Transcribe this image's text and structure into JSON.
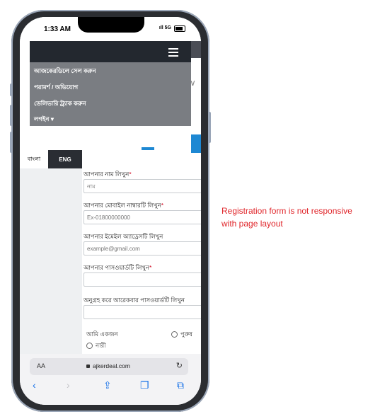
{
  "status": {
    "time": "1:33 AM",
    "signal": "5G"
  },
  "nav_menu": {
    "items": [
      "আজকেরডিলে সেল করুন",
      "পরামর্শ / অভিযোগ",
      "ডেলিভারি ট্র্যাক করুন",
      "লগইন ▾"
    ]
  },
  "language": {
    "bangla": "বাংলা",
    "english": "ENG"
  },
  "form": {
    "name_label": "আপনার নাম লিখুন",
    "name_placeholder": "নাম",
    "mobile_label": "আপনার মোবাইল নাম্বারটি লিখুন",
    "mobile_placeholder": "Ex-01800000000",
    "email_label": "আপনার ইমেইল অ্যাড্রেসটি লিখুন",
    "email_placeholder": "example@gmail.com",
    "password_label": "আপনার পাসওয়ার্ডটি লিখুন",
    "confirm_label": "অনুগ্রহ করে আরেকবার পাসওয়ার্ডটি লিখুন",
    "gender_label": "আমি একজন",
    "male": "পুরুষ",
    "female": "নারী",
    "required_mark": "*"
  },
  "browser": {
    "aa": "AA",
    "url": "ajkerdeal.com"
  },
  "annotation": "Registration form is not responsive with page layout",
  "colors": {
    "header": "#23282f",
    "menu": "#7a7d82",
    "accent": "#1e88d3",
    "annotation": "#e0262b"
  },
  "icons": [
    "hamburger-icon",
    "lock-icon",
    "reload-icon",
    "back-icon",
    "forward-icon",
    "share-icon",
    "bookmarks-icon",
    "tabs-icon"
  ]
}
